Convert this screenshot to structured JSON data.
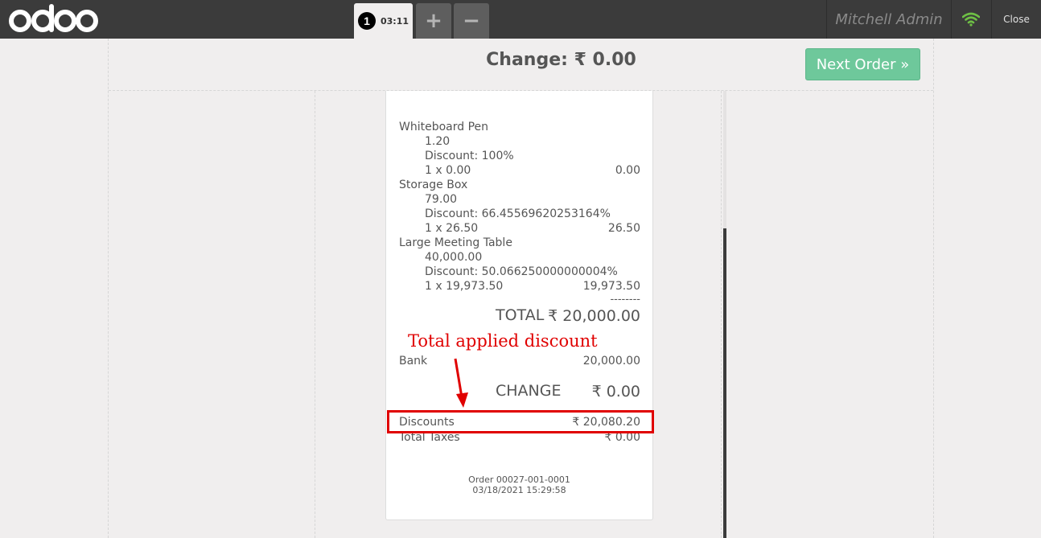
{
  "topbar": {
    "logo": "odoo",
    "order_tab": {
      "number": "1",
      "time": "03:11"
    },
    "add_order_symbol": "+",
    "remove_order_symbol": "−",
    "user_name": "Mitchell Admin",
    "wifi_icon": "wifi-icon",
    "close_label": "Close"
  },
  "screen": {
    "change_title": "Change: ₹ 0.00",
    "next_order_label": "Next Order »"
  },
  "receipt": {
    "items": [
      {
        "name": "Whiteboard Pen",
        "unit_price": "1.20",
        "discount": "Discount: 100%",
        "qty_line": "1 x 0.00",
        "total": "0.00"
      },
      {
        "name": "Storage Box",
        "unit_price": "79.00",
        "discount": "Discount: 66.45569620253164%",
        "qty_line": "1 x 26.50",
        "total": "26.50"
      },
      {
        "name": "Large Meeting Table",
        "unit_price": "40,000.00",
        "discount": "Discount: 50.066250000000004%",
        "qty_line": "1 x 19,973.50",
        "total": "19,973.50"
      }
    ],
    "separator": "--------",
    "total_label": "TOTAL",
    "total_value": "₹ 20,000.00",
    "payment_label": "Bank",
    "payment_value": "20,000.00",
    "change_label": "CHANGE",
    "change_value": "₹ 0.00",
    "discounts_label": "Discounts",
    "discounts_value": "₹ 20,080.20",
    "taxes_label": "Total Taxes",
    "taxes_value": "₹ 0.00",
    "order_ref": "Order 00027-001-0001",
    "order_date": "03/18/2021 15:29:58"
  },
  "annotation": {
    "text": "Total applied discount",
    "color": "#e00000"
  },
  "colors": {
    "topbar": "#3b3b3b",
    "background": "#f0eeee",
    "next_order_button": "#6ec89b",
    "wifi": "#6ec045"
  }
}
